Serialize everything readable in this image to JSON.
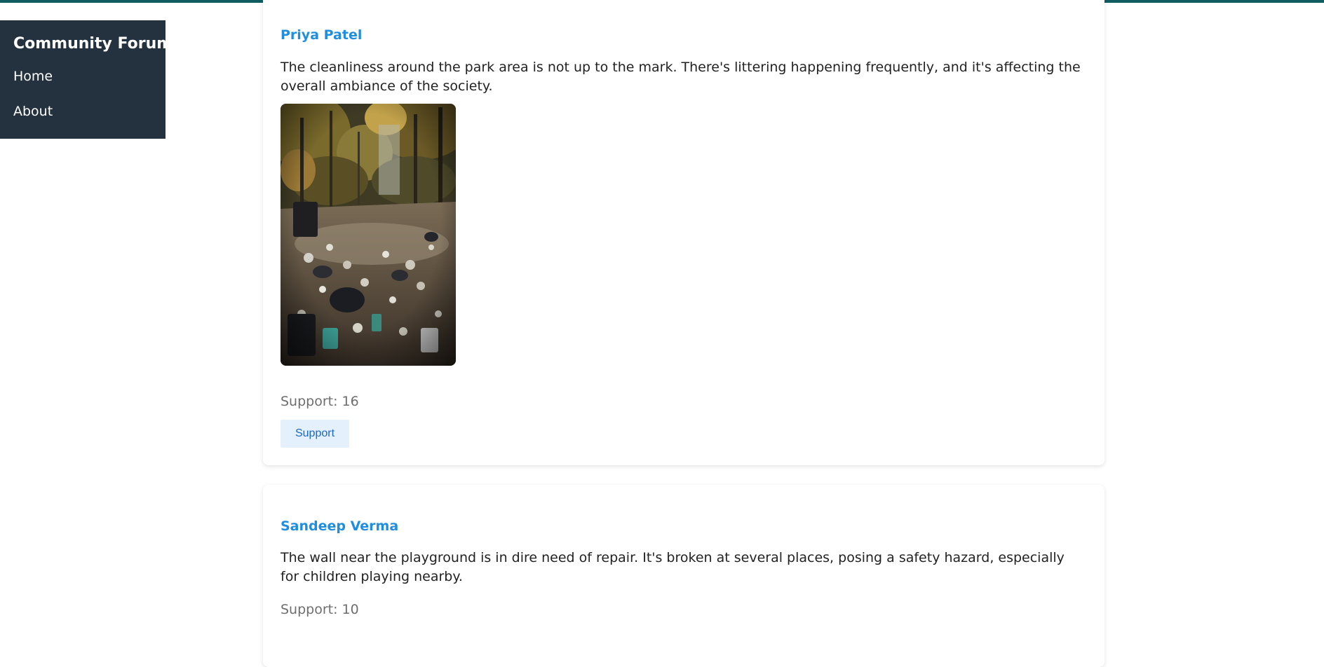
{
  "theme": {
    "accent_bar": "#0f5c63",
    "sidebar_bg": "#243240",
    "author_color": "#1f8ee0",
    "support_button_bg": "#e4f1fc",
    "support_button_text": "#1c66c7"
  },
  "sidebar": {
    "title": "Community Forum",
    "items": [
      {
        "label": "Home"
      },
      {
        "label": "About"
      }
    ]
  },
  "posts": [
    {
      "author": "Priya Patel",
      "text": "The cleanliness around the park area is not up to the mark. There's littering happening frequently, and it's affecting the overall ambiance of the society.",
      "image": "litter-in-park-photo",
      "support_count": "Support: 16",
      "support_button": "Support"
    },
    {
      "author": "Sandeep Verma",
      "text": "The wall near the playground is in dire need of repair. It's broken at several places, posing a safety hazard, especially for children playing nearby.",
      "support_count": "Support: 10"
    }
  ]
}
